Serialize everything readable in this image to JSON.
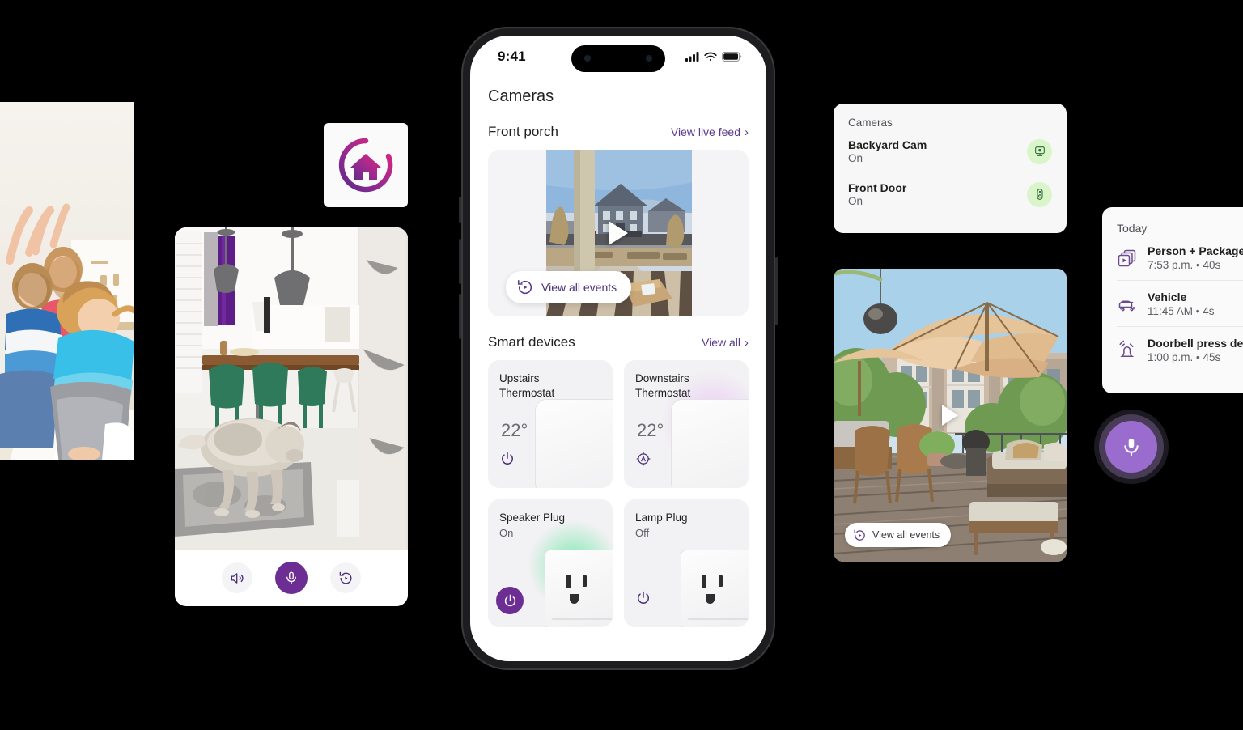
{
  "phone": {
    "status": {
      "time": "9:41",
      "signal_icon": "cellular-signal-icon",
      "wifi_icon": "wifi-icon",
      "battery_icon": "battery-icon"
    },
    "page_title": "Cameras",
    "camera_section": {
      "name": "Front porch",
      "live_link": "View live feed",
      "chevron": "›",
      "events_pill": "View all events",
      "play_icon": "play-icon"
    },
    "devices_section": {
      "title": "Smart devices",
      "view_all": "View all",
      "chevron": "›",
      "cards": [
        {
          "name": "Upstairs Thermostat",
          "value": "22°",
          "icon": "power-icon",
          "icon_style": "outline",
          "glow": "none"
        },
        {
          "name": "Downstairs Thermostat",
          "value": "22°",
          "icon": "auto-mode-icon",
          "icon_style": "outline",
          "glow": "violet"
        },
        {
          "name": "Speaker Plug",
          "value": "On",
          "icon": "power-icon",
          "icon_style": "filled",
          "glow": "green"
        },
        {
          "name": "Lamp Plug",
          "value": "Off",
          "icon": "power-icon",
          "icon_style": "outline",
          "glow": "none"
        }
      ]
    }
  },
  "logo": {
    "name": "home-plus-logo",
    "alt": "Home plus app logo"
  },
  "indoor_camera": {
    "scene": "living-room-with-dog",
    "controls": [
      {
        "name": "speaker-icon",
        "label": "Speaker",
        "style": "ghost"
      },
      {
        "name": "microphone-icon",
        "label": "Microphone",
        "style": "primary"
      },
      {
        "name": "replay-icon",
        "label": "Replay",
        "style": "ghost"
      }
    ]
  },
  "kids_photo": {
    "alt": "Children jumping in a living room"
  },
  "cameras_card": {
    "title": "Cameras",
    "rows": [
      {
        "name": "Backyard Cam",
        "state": "On",
        "icon": "security-camera-icon",
        "badge_color": "#d9f5c9"
      },
      {
        "name": "Front Door",
        "state": "On",
        "icon": "doorbell-icon",
        "badge_color": "#d9f5c9"
      }
    ]
  },
  "patio_card": {
    "scene": "outdoor-patio-deck",
    "events_pill": "View all events",
    "play_icon": "play-icon"
  },
  "today_card": {
    "title": "Today",
    "events": [
      {
        "icon": "video-clips-icon",
        "title": "Person + Package de",
        "meta": "7:53 p.m. • 40s"
      },
      {
        "icon": "car-icon",
        "title": "Vehicle",
        "meta": "11:45 AM • 4s"
      },
      {
        "icon": "doorbell-ring-icon",
        "title": "Doorbell press detec",
        "meta": "1:00 p.m. • 45s"
      }
    ]
  },
  "floating_mic": {
    "icon": "microphone-icon",
    "label": "Voice assistant"
  },
  "colors": {
    "accent_purple": "#6d2e93",
    "link_purple": "#5b3a8e",
    "mic_lavender": "#9a6ccd",
    "badge_green": "#d9f5c9",
    "card_grey": "#f2f1f3",
    "background": "#000000"
  }
}
